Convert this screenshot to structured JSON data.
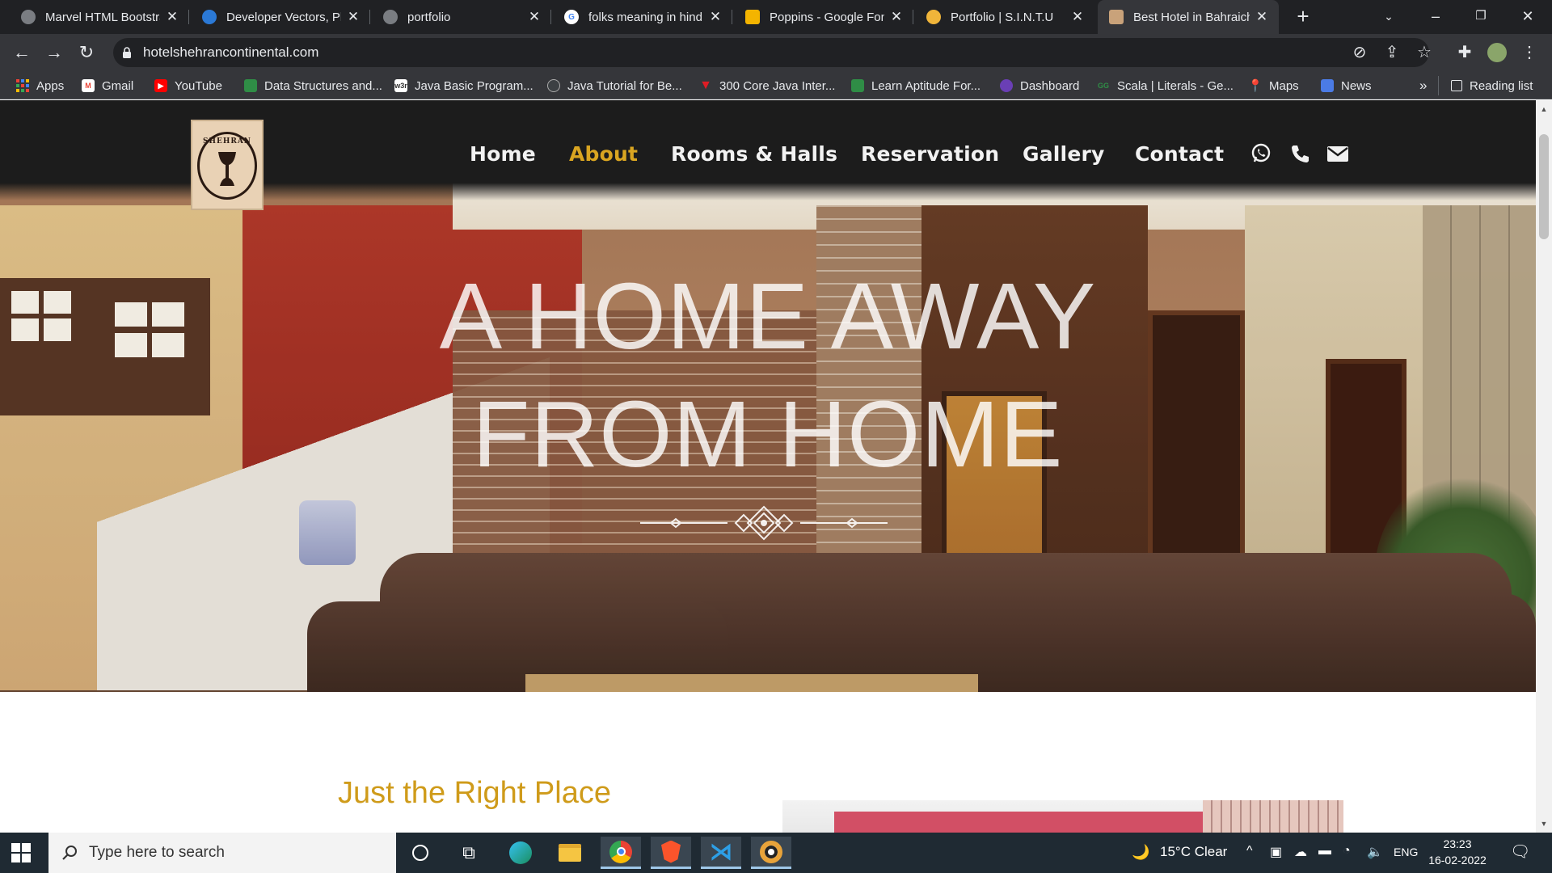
{
  "browser": {
    "tabs": [
      {
        "title": "Marvel HTML Bootstra",
        "favicon": "globe-icon"
      },
      {
        "title": "Developer Vectors, Ph",
        "favicon": "vecteezy-icon"
      },
      {
        "title": "portfolio",
        "favicon": "globe-icon"
      },
      {
        "title": "folks meaning in hind",
        "favicon": "google-icon"
      },
      {
        "title": "Poppins - Google Fon",
        "favicon": "google-fonts-icon"
      },
      {
        "title": "Portfolio | S.I.N.T.U",
        "favicon": "avatar-icon"
      },
      {
        "title": "Best Hotel in Bahraich",
        "favicon": "hotel-logo-icon",
        "active": true
      }
    ],
    "url": "hotelshehrancontinental.com",
    "bookmarks": [
      {
        "label": "Apps",
        "icon": "apps-grid-icon"
      },
      {
        "label": "Gmail",
        "icon": "gmail-icon"
      },
      {
        "label": "YouTube",
        "icon": "youtube-icon"
      },
      {
        "label": "Data Structures and...",
        "icon": "gfg-icon"
      },
      {
        "label": "Java Basic Program...",
        "icon": "w3r-icon"
      },
      {
        "label": "Java Tutorial for Be...",
        "icon": "javatpoint-icon"
      },
      {
        "label": "300 Core Java Inter...",
        "icon": "red-v-icon"
      },
      {
        "label": "Learn Aptitude For...",
        "icon": "gfg-icon"
      },
      {
        "label": "Dashboard",
        "icon": "dashboard-icon"
      },
      {
        "label": "Scala | Literals - Ge...",
        "icon": "gfg-icon"
      },
      {
        "label": "Maps",
        "icon": "maps-icon"
      },
      {
        "label": "News",
        "icon": "news-icon"
      }
    ],
    "overflow_label": "»",
    "reading_list": "Reading list"
  },
  "site": {
    "logo_text": "SHEHRAN",
    "nav": [
      {
        "label": "Home",
        "active": false
      },
      {
        "label": "About",
        "active": true
      },
      {
        "label": "Rooms & Halls",
        "active": false
      },
      {
        "label": "Reservation",
        "active": false
      },
      {
        "label": "Gallery",
        "active": false
      },
      {
        "label": "Contact",
        "active": false
      }
    ],
    "hero_title_line1": "A HOME AWAY",
    "hero_title_line2": "FROM HOME",
    "section_title": "Just the Right Place",
    "colors": {
      "nav_active": "#d9a521",
      "header_bg": "#1c1c1c",
      "section_title": "#cf9b1a"
    }
  },
  "taskbar": {
    "search_placeholder": "Type here to search",
    "weather": "15°C  Clear",
    "language": "ENG",
    "time": "23:23",
    "date": "16-02-2022"
  }
}
